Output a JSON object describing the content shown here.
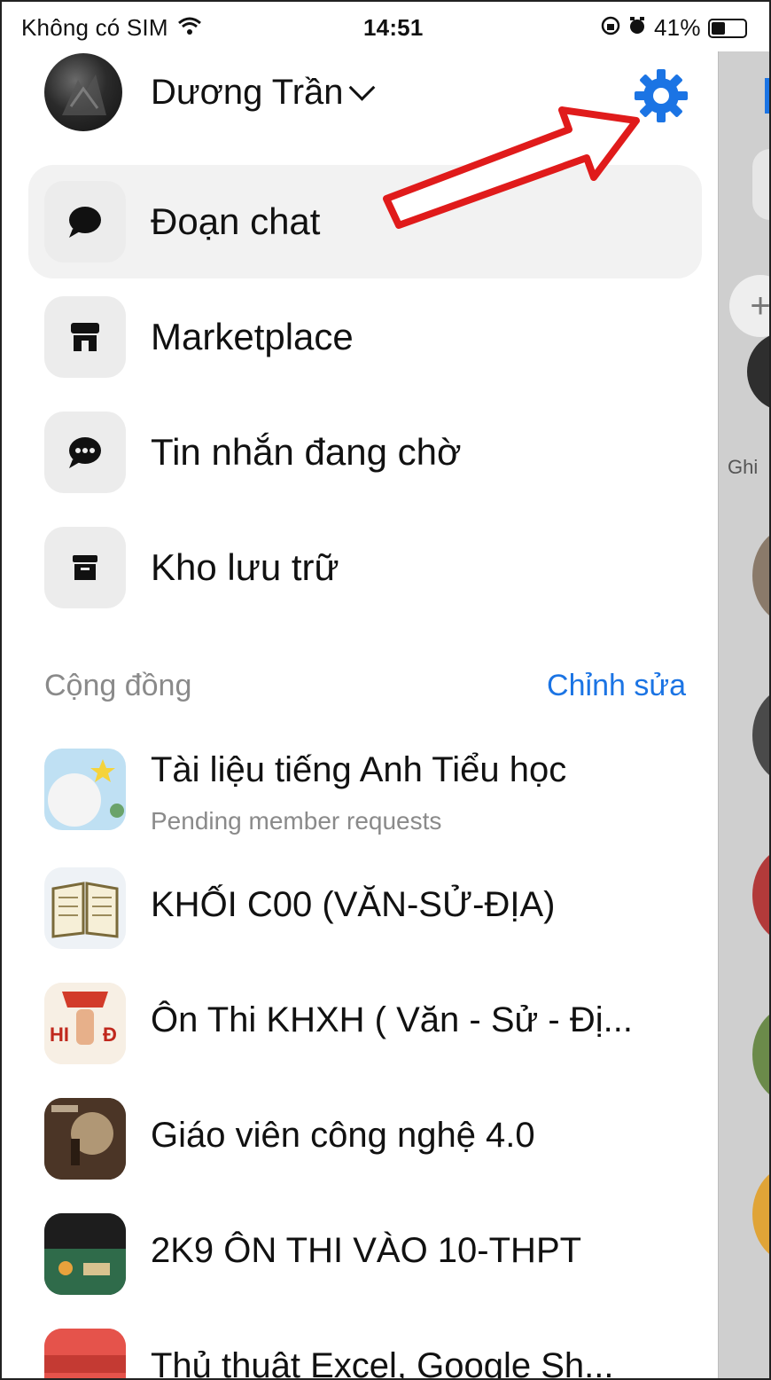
{
  "status_bar": {
    "carrier": "Không có SIM",
    "time": "14:51",
    "battery": "41%",
    "battery_level": 0.41
  },
  "profile": {
    "name": "Dương Trần"
  },
  "menu": [
    {
      "label": "Đoạn chat",
      "icon": "chat-bubble-icon",
      "active": true
    },
    {
      "label": "Marketplace",
      "icon": "storefront-icon",
      "active": false
    },
    {
      "label": "Tin nhắn đang chờ",
      "icon": "pending-chat-icon",
      "active": false
    },
    {
      "label": "Kho lưu trữ",
      "icon": "archive-box-icon",
      "active": false
    }
  ],
  "communities_section": {
    "title": "Cộng đồng",
    "edit_label": "Chỉnh sửa"
  },
  "communities": [
    {
      "name": "Tài liệu tiếng Anh Tiểu học",
      "subtitle": "Pending member requests"
    },
    {
      "name": "KHỐI C00 (VĂN-SỬ-ĐỊA)",
      "subtitle": ""
    },
    {
      "name": "Ôn Thi KHXH ( Văn - Sử - Đị...",
      "subtitle": ""
    },
    {
      "name": "Giáo viên công nghệ 4.0",
      "subtitle": ""
    },
    {
      "name": "2K9 ÔN THI VÀO 10-THPT",
      "subtitle": ""
    },
    {
      "name": "Thủ thuật Excel, Google Sh...",
      "subtitle": ""
    }
  ],
  "peek": {
    "ghi_label": "Ghi"
  },
  "colors": {
    "accent": "#1b74e4",
    "annotation_arrow": "#e01b1b"
  }
}
